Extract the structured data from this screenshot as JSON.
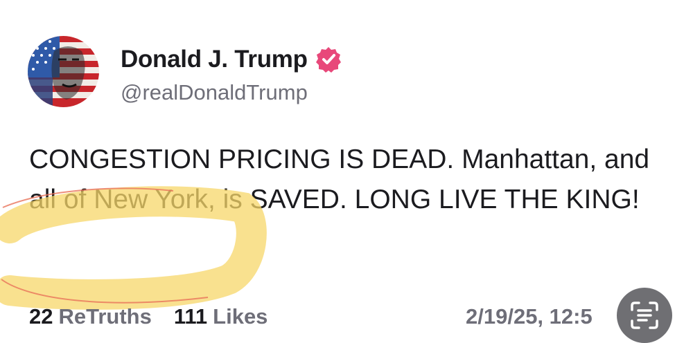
{
  "author": {
    "display_name": "Donald J. Trump",
    "handle": "@realDonaldTrump",
    "verified_icon": "verified-badge-icon",
    "badge_color": "#e8487a"
  },
  "post": {
    "text": "CONGESTION PRICING IS DEAD. Manhattan, and all of New York, is SAVED. LONG LIVE THE KING!"
  },
  "stats": {
    "retruths_count": "22",
    "retruths_label": "ReTruths",
    "likes_count": "111",
    "likes_label": "Likes"
  },
  "timestamp": "2/19/25, 12:5",
  "overlay": {
    "scan_button_icon": "live-text-scan-icon",
    "highlight_color": "#f7d76a",
    "annotation_line_color": "#e8735a"
  }
}
